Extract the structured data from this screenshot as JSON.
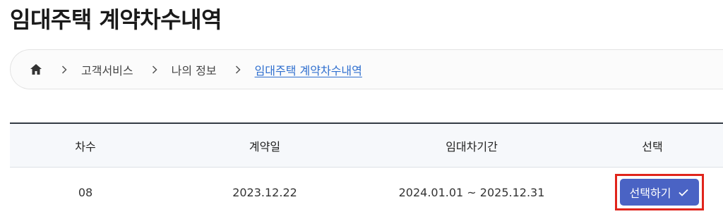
{
  "page": {
    "title": "임대주택 계약차수내역"
  },
  "breadcrumb": {
    "items": [
      {
        "label": "고객서비스",
        "icon": "chevron-right-icon"
      },
      {
        "label": "나의 정보",
        "icon": "chevron-right-icon"
      },
      {
        "label": "임대주택 계약차수내역",
        "icon": "chevron-right-icon",
        "current": true
      }
    ],
    "home_icon": "home-icon",
    "link_color": "#2f6fcf"
  },
  "table": {
    "headers": [
      "차수",
      "계약일",
      "임대차기간",
      "선택"
    ],
    "rows": [
      {
        "degree": "08",
        "contract_date": "2023.12.22",
        "lease_period": "2024.01.01 ~ 2025.12.31",
        "action_label": "선택하기",
        "action_icon": "check-icon"
      }
    ]
  },
  "colors": {
    "button_bg": "#4a63c4",
    "highlight_border": "#e0241b",
    "header_rule": "#333a44"
  }
}
